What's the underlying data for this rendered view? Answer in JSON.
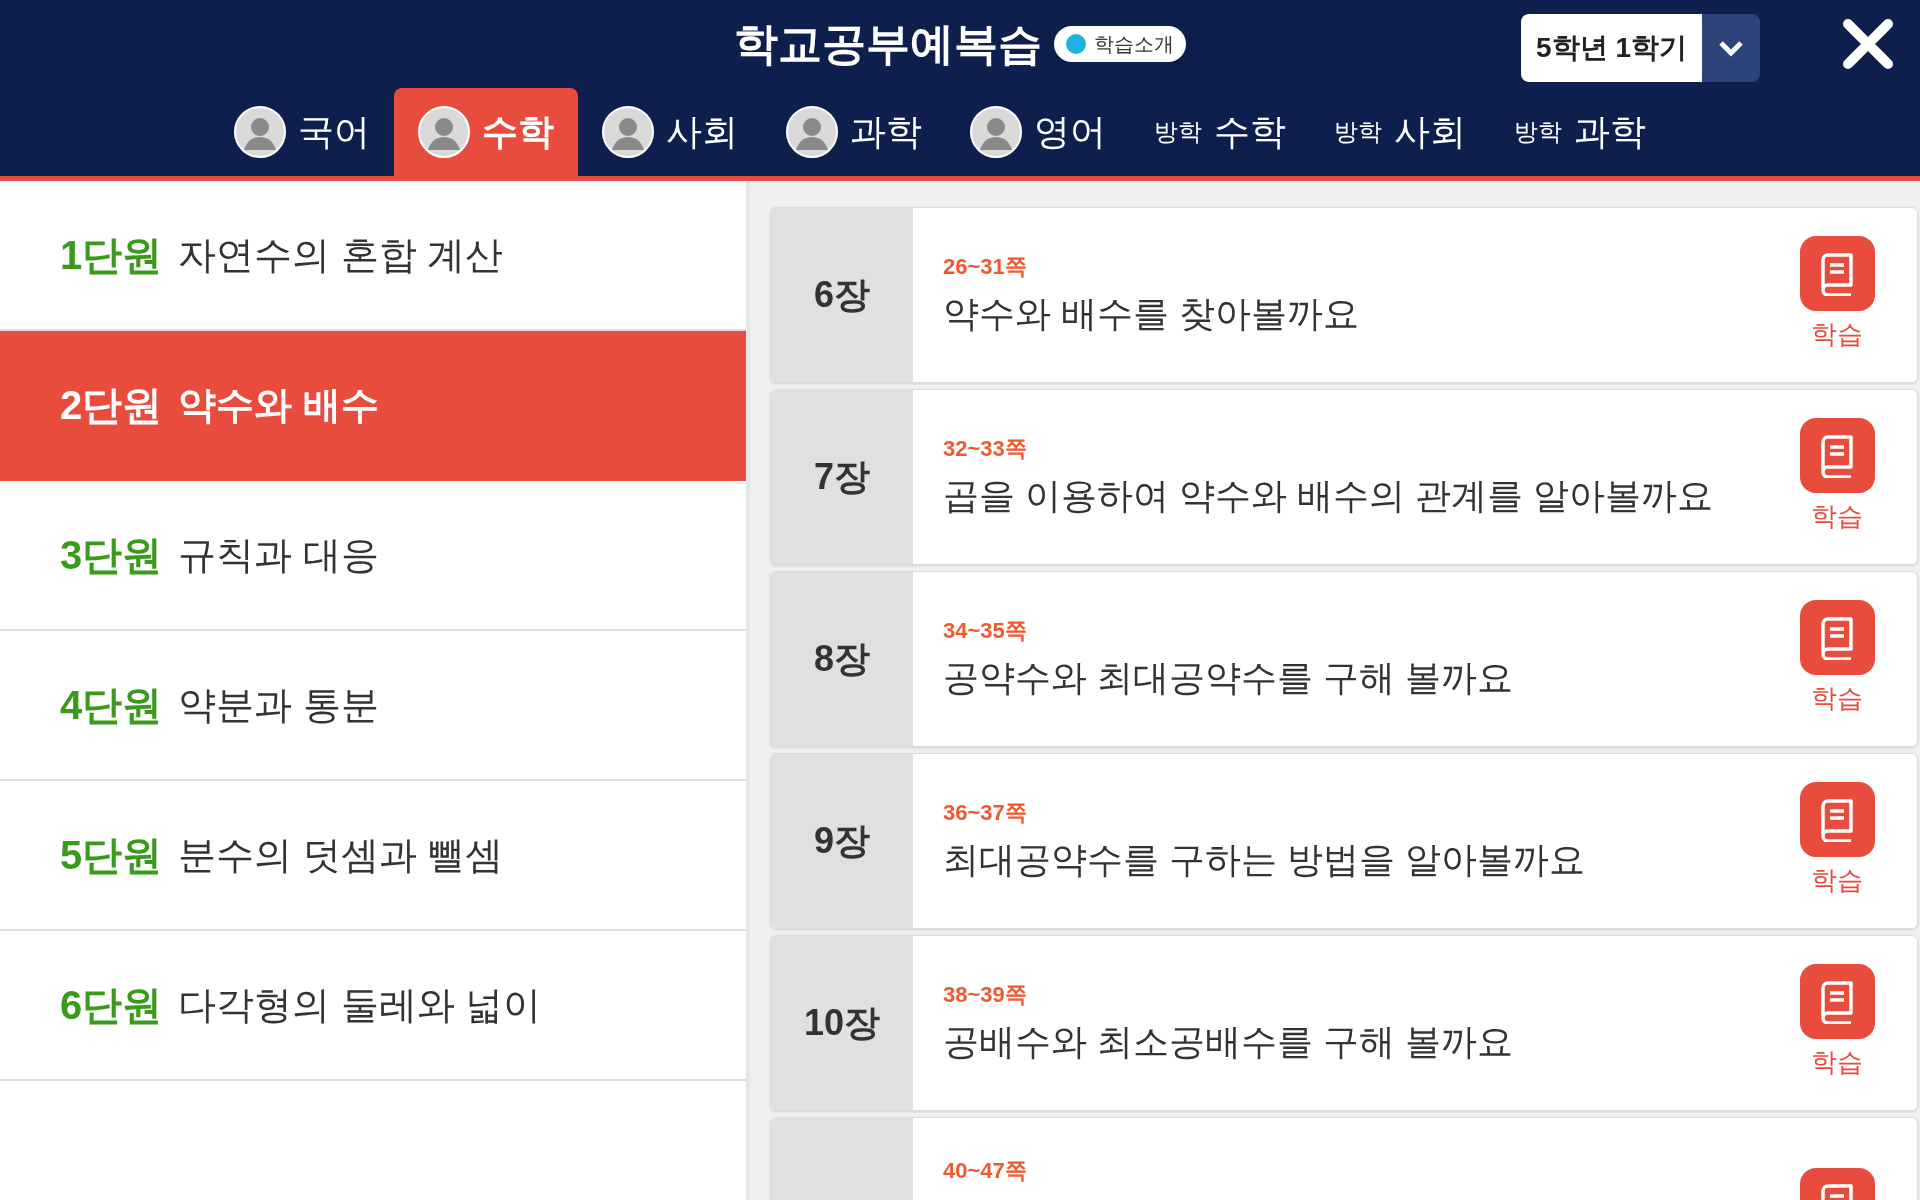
{
  "header": {
    "title": "학교공부예복습",
    "intro_button": "학습소개",
    "semester": "5학년 1학기"
  },
  "tabs": [
    {
      "kind": "icon",
      "label": "국어",
      "selected": false
    },
    {
      "kind": "icon",
      "label": "수학",
      "selected": true
    },
    {
      "kind": "icon",
      "label": "사회",
      "selected": false
    },
    {
      "kind": "icon",
      "label": "과학",
      "selected": false
    },
    {
      "kind": "icon",
      "label": "영어",
      "selected": false
    },
    {
      "kind": "vacation",
      "prefix": "방학",
      "label": "수학",
      "selected": false
    },
    {
      "kind": "vacation",
      "prefix": "방학",
      "label": "사회",
      "selected": false
    },
    {
      "kind": "vacation",
      "prefix": "방학",
      "label": "과학",
      "selected": false
    }
  ],
  "units": [
    {
      "number": "1단원",
      "title": "자연수의 혼합 계산",
      "selected": false
    },
    {
      "number": "2단원",
      "title": "약수와 배수",
      "selected": true
    },
    {
      "number": "3단원",
      "title": "규칙과 대응",
      "selected": false
    },
    {
      "number": "4단원",
      "title": "약분과 통분",
      "selected": false
    },
    {
      "number": "5단원",
      "title": "분수의 덧셈과 뺄셈",
      "selected": false
    },
    {
      "number": "6단원",
      "title": "다각형의 둘레와 넓이",
      "selected": false
    }
  ],
  "lessons": [
    {
      "chapter": "6장",
      "pages": "26~31쪽",
      "title": "약수와 배수를 찾아볼까요",
      "button": "학습"
    },
    {
      "chapter": "7장",
      "pages": "32~33쪽",
      "title": "곱을 이용하여 약수와 배수의 관계를 알아볼까요",
      "button": "학습"
    },
    {
      "chapter": "8장",
      "pages": "34~35쪽",
      "title": "공약수와 최대공약수를 구해 볼까요",
      "button": "학습"
    },
    {
      "chapter": "9장",
      "pages": "36~37쪽",
      "title": "최대공약수를 구하는 방법을 알아볼까요",
      "button": "학습"
    },
    {
      "chapter": "10장",
      "pages": "38~39쪽",
      "title": "공배수와 최소공배수를 구해 볼까요",
      "button": "학습"
    },
    {
      "pages": "40~47쪽"
    }
  ]
}
